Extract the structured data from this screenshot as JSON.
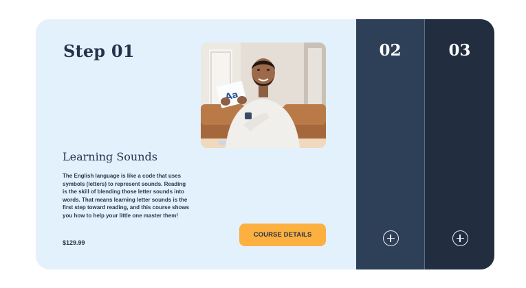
{
  "steps": [
    {
      "number_label": "Step 01",
      "course": {
        "title": "Learning Sounds",
        "description": "The English language is like a code that uses symbols (letters) to represent sounds. Reading is the skill of blending those letter sounds into words. That means learning letter sounds is the first step toward reading, and this course shows you how to help your little one master them!",
        "price": "$129.99",
        "card_text": "Aa"
      },
      "button_label": "COURSE DETAILS",
      "state": "expanded"
    },
    {
      "number_label": "02",
      "state": "collapsed",
      "icon": "plus-circle-icon"
    },
    {
      "number_label": "03",
      "state": "collapsed",
      "icon": "plus-circle-icon"
    }
  ],
  "colors": {
    "expanded_panel": "#e3f1fd",
    "panel_02": "#2e3f58",
    "panel_03": "#222e40",
    "heading_text": "#243349",
    "button": "#fbb040"
  }
}
